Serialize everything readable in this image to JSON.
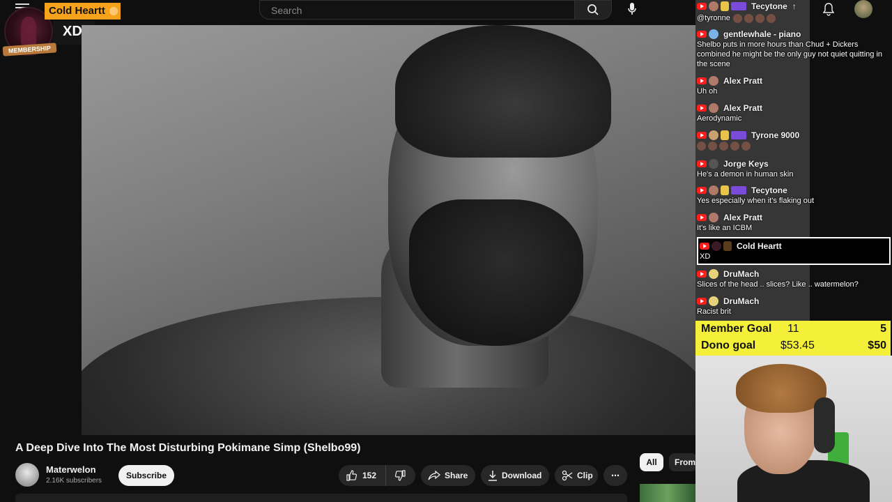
{
  "search": {
    "placeholder": "Search"
  },
  "alert": {
    "name": "Cold Heartt",
    "message": "XD",
    "tag": "MEMBERSHIP"
  },
  "video": {
    "title": "A Deep Dive Into The Most Disturbing Pokimane Simp (Shelbo99)",
    "channel": "Materwelon",
    "subscribers": "2.16K subscribers",
    "subscribe_label": "Subscribe",
    "likes": "152",
    "share_label": "Share",
    "download_label": "Download",
    "clip_label": "Clip",
    "more_label": "⋯"
  },
  "chips": {
    "all": "All",
    "from": "From"
  },
  "chat": {
    "top_user": "Tecytone",
    "top_text": "@tyronne",
    "messages": [
      {
        "user": "gentlewhale - piano",
        "text": "Shelbo puts in more hours than Chud + Dickers combined he might be the only guy not quiet quitting in the scene"
      },
      {
        "user": "Alex Pratt",
        "text": "Uh oh"
      },
      {
        "user": "Alex Pratt",
        "text": "Aerodynamic"
      },
      {
        "user": "Tyrone 9000",
        "text": ""
      },
      {
        "user": "Jorge Keys",
        "text": "He's a demon in human skin"
      },
      {
        "user": "Tecytone",
        "text": "Yes especially when it's flaking out"
      },
      {
        "user": "Alex Pratt",
        "text": "It's like an ICBM"
      },
      {
        "user": "Cold Heartt",
        "text": "XD"
      },
      {
        "user": "DruMach",
        "text": "Slices of the head .. slices? Like .. watermelon?"
      },
      {
        "user": "DruMach",
        "text": "Racist brit"
      }
    ]
  },
  "goals": {
    "member": {
      "label": "Member Goal",
      "current": "11",
      "target": "5"
    },
    "dono": {
      "label": "Dono goal",
      "current": "$53.45",
      "target": "$50"
    }
  },
  "colors": {
    "accent": "#f7a21b",
    "goal_bg": "#f4f03a",
    "yt_red": "#ff1d1d"
  }
}
